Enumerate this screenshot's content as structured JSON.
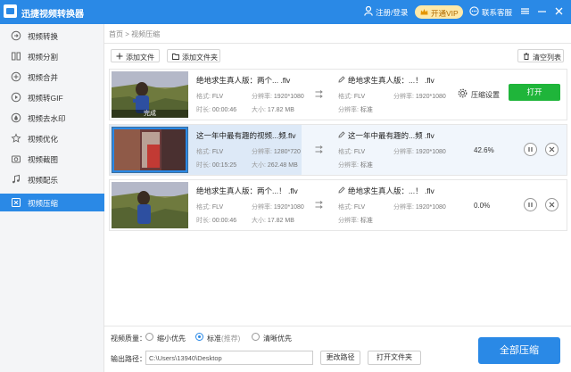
{
  "window": {
    "title": "迅捷视频转换器",
    "login_label": "注册/登录",
    "vip_label": "开通VIP",
    "support_label": "联系客服"
  },
  "sidebar": {
    "items": [
      {
        "label": "视频转换",
        "icon": "video-convert-icon"
      },
      {
        "label": "视频分割",
        "icon": "split-icon"
      },
      {
        "label": "视频合并",
        "icon": "merge-icon"
      },
      {
        "label": "视频转GIF",
        "icon": "gif-icon"
      },
      {
        "label": "视频去水印",
        "icon": "watermark-icon"
      },
      {
        "label": "视频优化",
        "icon": "optimize-icon"
      },
      {
        "label": "视频截图",
        "icon": "screenshot-icon"
      },
      {
        "label": "视频配乐",
        "icon": "music-icon"
      },
      {
        "label": "视频压缩",
        "icon": "compress-icon"
      }
    ],
    "active_index": 8
  },
  "breadcrumb": {
    "home": "首页",
    "sep": ">",
    "current": "视频压缩"
  },
  "toolbar": {
    "add_file": "添加文件",
    "add_folder": "添加文件夹",
    "clear_list": "清空列表"
  },
  "labels": {
    "format": "格式:",
    "resolution": "分辨率:",
    "duration": "时长:",
    "size": "大小:",
    "done": "完成",
    "compress_settings": "压缩设置",
    "open": "打开"
  },
  "files": [
    {
      "name": "绝地求生真人版：两个... .flv",
      "format": "FLV",
      "resolution": "1920*1080",
      "duration": "00:00:46",
      "size": "17.82 MB",
      "out_name": "绝地求生真人版：...！ .flv",
      "out_format": "FLV",
      "out_resolution": "1920*1080",
      "out_quality": "标准",
      "status": "done"
    },
    {
      "name": "这一年中最有趣的视频...频.flv",
      "format": "FLV",
      "resolution": "1280*720",
      "duration": "00:15:25",
      "size": "262.48 MB",
      "out_name": "这一年中最有趣的...频 .flv",
      "out_format": "FLV",
      "out_resolution": "1920*1080",
      "out_quality": "标准",
      "status": "progress",
      "percent": "42.6%",
      "progress": 0.42
    },
    {
      "name": "绝地求生真人版：两个...！ .flv",
      "format": "FLV",
      "resolution": "1920*1080",
      "duration": "00:00:46",
      "size": "17.82 MB",
      "out_name": "绝地求生真人版：...！ .flv",
      "out_format": "FLV",
      "out_resolution": "1920*1080",
      "out_quality": "标准",
      "status": "waiting",
      "percent": "0.0%"
    }
  ],
  "bottom": {
    "quality_label": "视频质量：",
    "options": [
      {
        "label": "缩小优先",
        "sub": "",
        "checked": false
      },
      {
        "label": "标准",
        "sub": "(推荐)",
        "checked": true
      },
      {
        "label": "清晰优先",
        "sub": "",
        "checked": false
      }
    ],
    "output_label": "输出路径：",
    "output_path": "C:\\Users\\13940\\Desktop",
    "change_path": "更改路径",
    "open_folder": "打开文件夹",
    "start": "全部压缩"
  },
  "colors": {
    "accent": "#2a89e6",
    "open_button": "#1fb53a",
    "vip": "#ffe9a8"
  }
}
